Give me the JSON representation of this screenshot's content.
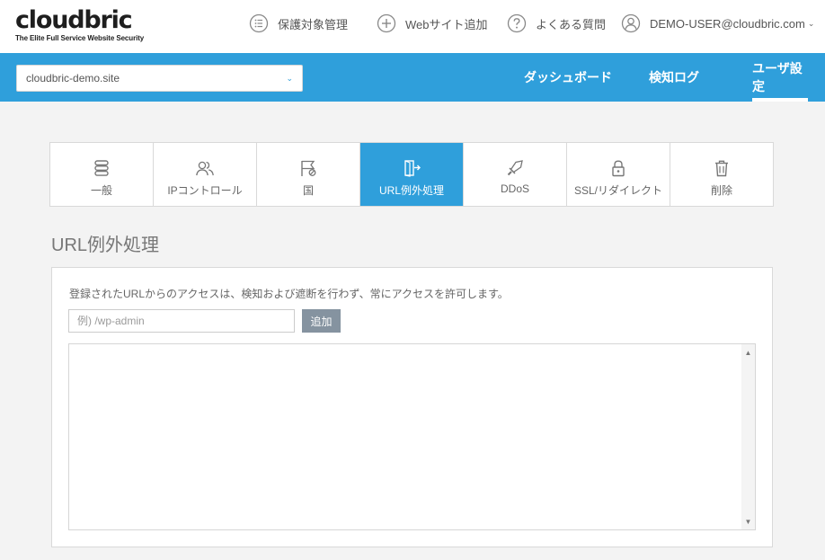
{
  "logo": {
    "wordmark": "cloudbric",
    "tagline": "The Elite Full Service Website Security"
  },
  "topnav": {
    "items": [
      {
        "label": "保護対象管理",
        "icon": "list-icon"
      },
      {
        "label": "Webサイト追加",
        "icon": "plus-circle-icon"
      },
      {
        "label": "よくある質問",
        "icon": "question-icon"
      }
    ],
    "user": {
      "label": "DEMO-USER@cloudbric.com",
      "caret": "⌄"
    }
  },
  "site_select": {
    "value": "cloudbric-demo.site",
    "caret": "⌄"
  },
  "mainnav": {
    "items": [
      {
        "label": "ダッシュボード"
      },
      {
        "label": "検知ログ"
      },
      {
        "label": "ユーザ設定",
        "active": true
      }
    ]
  },
  "tabs": [
    {
      "label": "一般",
      "icon": "database-icon"
    },
    {
      "label": "IPコントロール",
      "icon": "users-icon"
    },
    {
      "label": "国",
      "icon": "flag-block-icon"
    },
    {
      "label": "URL例外処理",
      "icon": "door-exit-icon",
      "active": true
    },
    {
      "label": "DDoS",
      "icon": "sword-icon"
    },
    {
      "label": "SSL/リダイレクト",
      "icon": "lock-icon"
    },
    {
      "label": "削除",
      "icon": "trash-icon"
    }
  ],
  "section": {
    "title": "URL例外処理",
    "description": "登録されたURLからのアクセスは、検知および遮断を行わず、常にアクセスを許可します。",
    "input_placeholder": "例) /wp-admin",
    "add_label": "追加"
  },
  "colors": {
    "accent": "#2f9fdb",
    "button_gray": "#8593a0",
    "background": "#f3f3f3"
  }
}
